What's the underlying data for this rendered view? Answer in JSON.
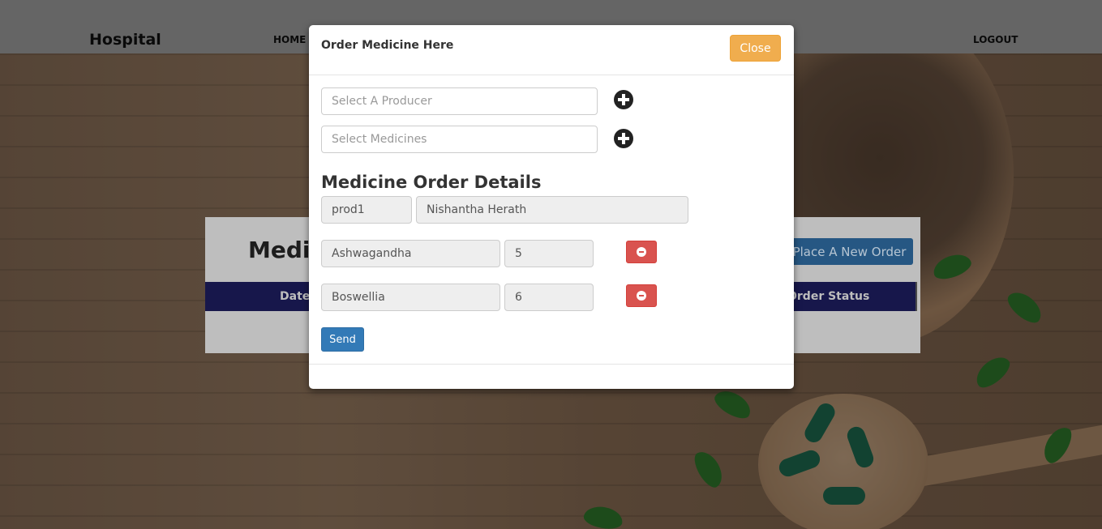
{
  "nav": {
    "brand": "Hospital",
    "home": "HOME",
    "logout": "LOGOUT"
  },
  "panel": {
    "title": "Medi",
    "new_order_button": "Place A New Order",
    "columns": [
      "Date",
      "Order Status"
    ]
  },
  "modal": {
    "title": "Order Medicine Here",
    "close_label": "Close",
    "producer_placeholder": "Select A Producer",
    "medicines_placeholder": "Select Medicines",
    "section_title": "Medicine Order Details",
    "producer": {
      "id": "prod1",
      "name": "Nishantha Herath"
    },
    "items": [
      {
        "name": "Ashwagandha",
        "quantity": "5"
      },
      {
        "name": "Boswellia",
        "quantity": "6"
      }
    ],
    "send_label": "Send"
  },
  "colors": {
    "close_button": "#f0ad4e",
    "send_button": "#337ab7",
    "remove_button": "#d9534f",
    "table_header": "#1b1b56"
  },
  "icons": {
    "add_producer": "plus-circle-icon",
    "add_medicine": "plus-circle-icon",
    "remove_item": "minus-circle-icon"
  }
}
